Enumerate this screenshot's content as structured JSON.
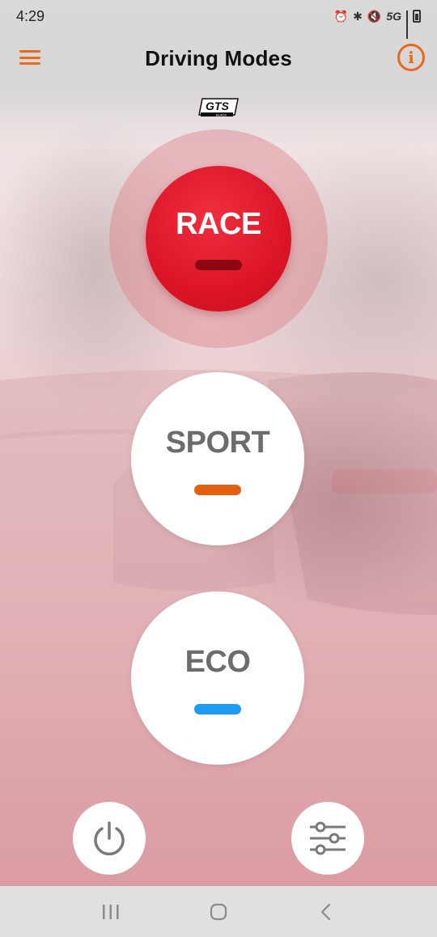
{
  "status_bar": {
    "time": "4:29",
    "network": "5G"
  },
  "header": {
    "title": "Driving Modes",
    "menu_icon": "hamburger-menu-icon",
    "info_icon": "info-icon",
    "info_glyph": "i"
  },
  "brand": {
    "logo_text": "GTS",
    "logo_subtext": "BLACK"
  },
  "modes": [
    {
      "label": "RACE",
      "indicator_color": "#8d0712",
      "active": true
    },
    {
      "label": "SPORT",
      "indicator_color": "#e2600f",
      "active": false
    },
    {
      "label": "ECO",
      "indicator_color": "#1d9af2",
      "active": false
    }
  ],
  "actions": {
    "power_icon": "power-icon",
    "settings_icon": "sliders-icon"
  },
  "nav": {
    "recents_icon": "recents-icon",
    "home_icon": "home-icon",
    "back_icon": "back-icon"
  },
  "colors": {
    "accent": "#e8691c",
    "race_red": "#dc1528"
  }
}
